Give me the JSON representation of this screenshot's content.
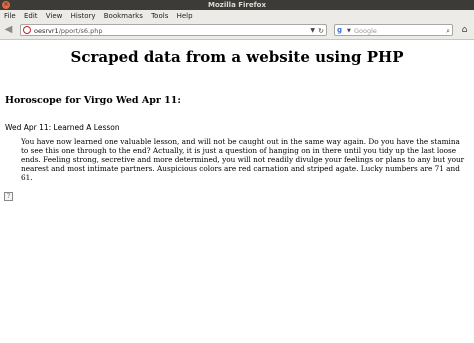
{
  "window": {
    "title": "Mozilla Firefox"
  },
  "menu": {
    "file": "File",
    "edit": "Edit",
    "view": "View",
    "history": "History",
    "bookmarks": "Bookmarks",
    "tools": "Tools",
    "help": "Help"
  },
  "urlbar": {
    "host": "oesrvr1",
    "path": "/pport/s6.php"
  },
  "search": {
    "placeholder": "Google",
    "engine_icon": "google-icon"
  },
  "page": {
    "title": "Scraped data from a website using PHP",
    "horoscope_heading": "Horoscope for Virgo Wed Apr 11:",
    "entry_title": "Wed Apr 11: Learned A Lesson",
    "entry_text": "You have now learned one valuable lesson, and will not be caught out in the same way again. Do you have the stamina to see this one through to the end? Actually, it is just a question of hanging on in there until you tidy up the last loose ends. Feeling strong, secretive and more determined, you will not readily divulge your feelings or plans to any but your nearest and most intimate partners. Auspicious colors are red carnation and striped agate. Lucky numbers are 71 and 61."
  },
  "colors": {
    "titlebar": "#3c3b37",
    "close_button": "#e0663f",
    "chrome": "#edebe8"
  }
}
